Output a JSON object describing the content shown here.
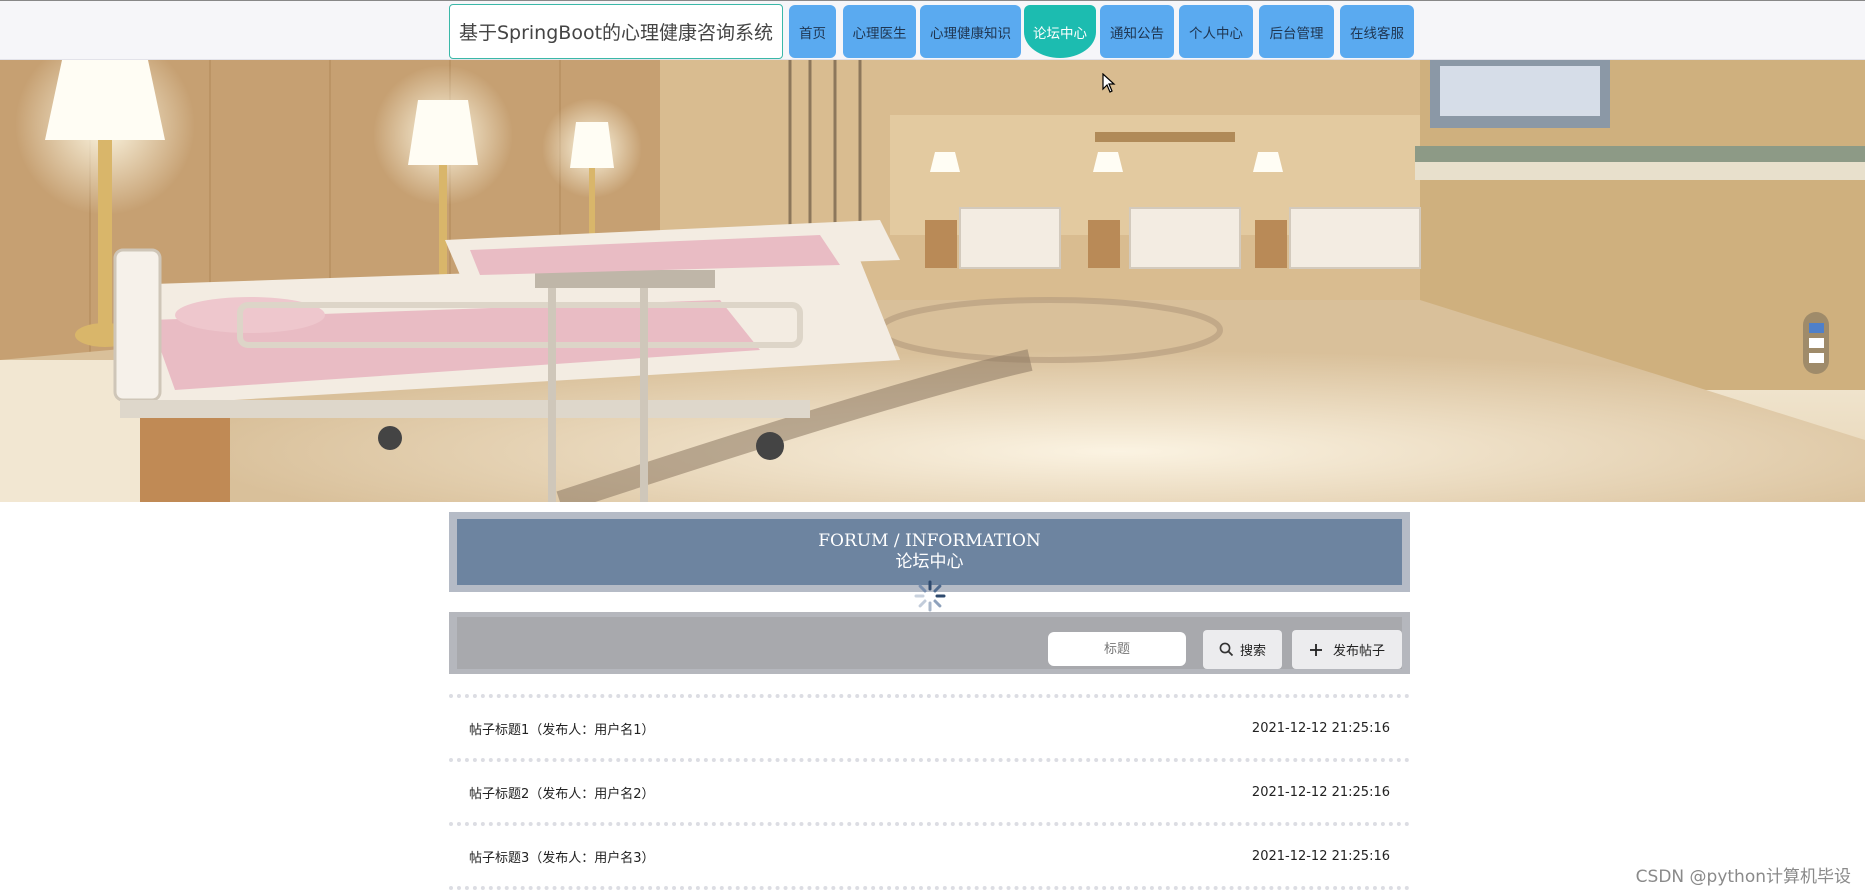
{
  "header": {
    "site_title": "基于SpringBoot的心理健康咨询系统",
    "nav": [
      "首页",
      "心理医生",
      "心理健康知识",
      "论坛中心",
      "通知公告",
      "个人中心",
      "后台管理",
      "在线客服"
    ],
    "active_nav": "论坛中心"
  },
  "banner": {
    "slide_count": 3,
    "active_slide": 1
  },
  "section": {
    "title_en": "FORUM / INFORMATION",
    "title_zh": "论坛中心"
  },
  "search": {
    "placeholder": "标题",
    "search_label": "搜索",
    "publish_label": "发布帖子"
  },
  "posts": [
    {
      "title": "帖子标题1（发布人：用户名1）",
      "time": "2021-12-12 21:25:16"
    },
    {
      "title": "帖子标题2（发布人：用户名2）",
      "time": "2021-12-12 21:25:16"
    },
    {
      "title": "帖子标题3（发布人：用户名3）",
      "time": "2021-12-12 21:25:16"
    }
  ],
  "watermark": "CSDN @python计算机毕设",
  "colors": {
    "nav_button": "#5aaaf0",
    "nav_active": "#1cbcb0",
    "section_header": "#6d84a0"
  }
}
